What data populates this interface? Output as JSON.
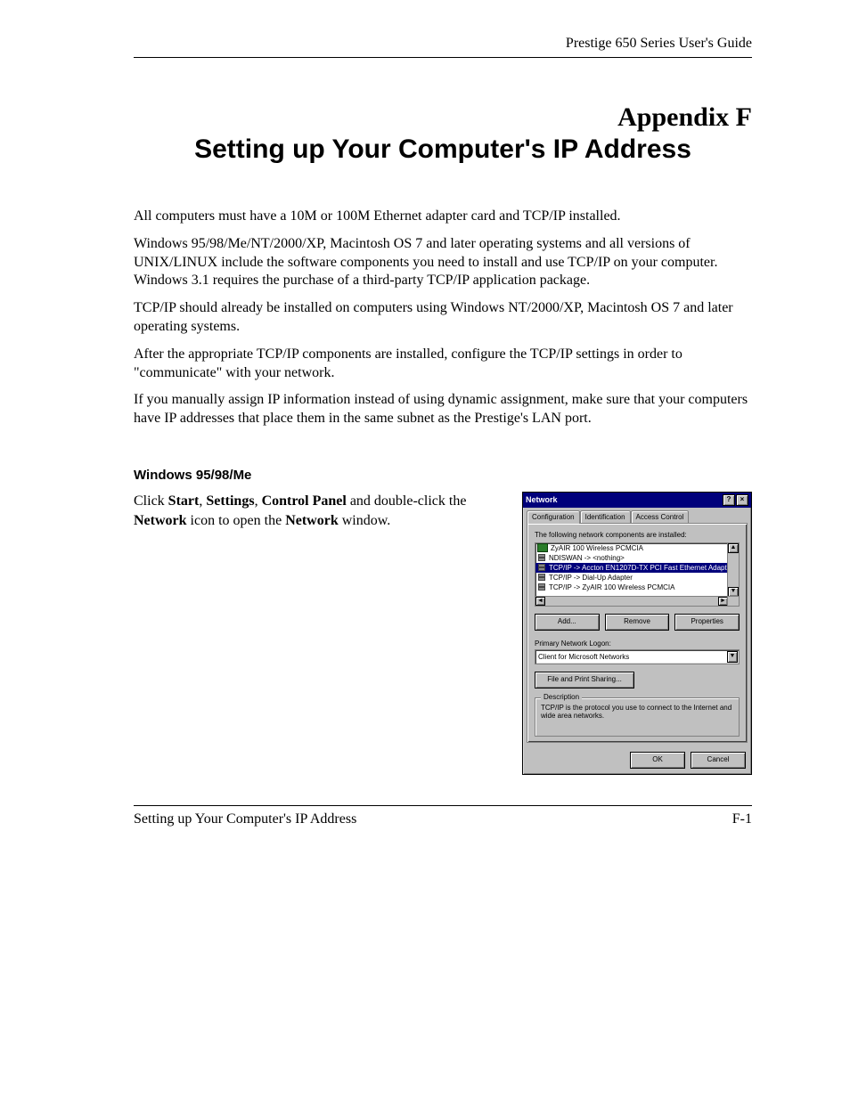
{
  "header": {
    "guide_title": "Prestige 650 Series User's Guide"
  },
  "title": {
    "appendix_label": "Appendix F",
    "main": "Setting up Your Computer's IP Address"
  },
  "paragraphs": {
    "p1": "All computers must have a 10M or 100M Ethernet adapter card and TCP/IP installed.",
    "p2": "Windows 95/98/Me/NT/2000/XP, Macintosh OS 7 and later operating systems and all versions of UNIX/LINUX include the software components you need to install and use TCP/IP on your computer. Windows 3.1 requires the purchase of a third-party TCP/IP application package.",
    "p3": "TCP/IP should already be installed on computers using Windows NT/2000/XP, Macintosh OS 7 and later operating systems.",
    "p4": "After the appropriate TCP/IP components are installed, configure the TCP/IP settings in order to \"communicate\" with your network.",
    "p5": "If you manually assign IP information instead of using dynamic assignment, make sure that your computers have IP addresses that place them in the same subnet as the Prestige's LAN port."
  },
  "section": {
    "heading": "Windows 95/98/Me",
    "instruction_parts": {
      "t1": "Click ",
      "b1": "Start",
      "t2": ", ",
      "b2": "Settings",
      "t3": ", ",
      "b3": "Control Panel",
      "t4": " and double-click the ",
      "b4": "Network",
      "t5": " icon to open the ",
      "b5": "Network",
      "t6": " window."
    }
  },
  "dialog": {
    "title": "Network",
    "help_glyph": "?",
    "close_glyph": "×",
    "tabs": {
      "configuration": "Configuration",
      "identification": "Identification",
      "access_control": "Access Control"
    },
    "components_label": "The following network components are installed:",
    "list": {
      "i0": "ZyAIR 100 Wireless PCMCIA",
      "i1": "NDISWAN -> <nothing>",
      "i2": "TCP/IP -> Accton EN1207D-TX PCI Fast Ethernet Adapt",
      "i3": "TCP/IP -> Dial-Up Adapter",
      "i4": "TCP/IP -> ZyAIR 100 Wireless PCMCIA"
    },
    "scroll": {
      "up": "▲",
      "down": "▼",
      "left": "◄",
      "right": "►"
    },
    "buttons": {
      "add": "Add...",
      "remove": "Remove",
      "properties": "Properties"
    },
    "logon_label": "Primary Network Logon:",
    "logon_value": "Client for Microsoft Networks",
    "file_print_sharing": "File and Print Sharing...",
    "description": {
      "legend": "Description",
      "text": "TCP/IP is the protocol you use to connect to the Internet and wide area networks."
    },
    "footer": {
      "ok": "OK",
      "cancel": "Cancel"
    }
  },
  "footer": {
    "left": "Setting up Your Computer's IP Address",
    "right": "F-1"
  }
}
